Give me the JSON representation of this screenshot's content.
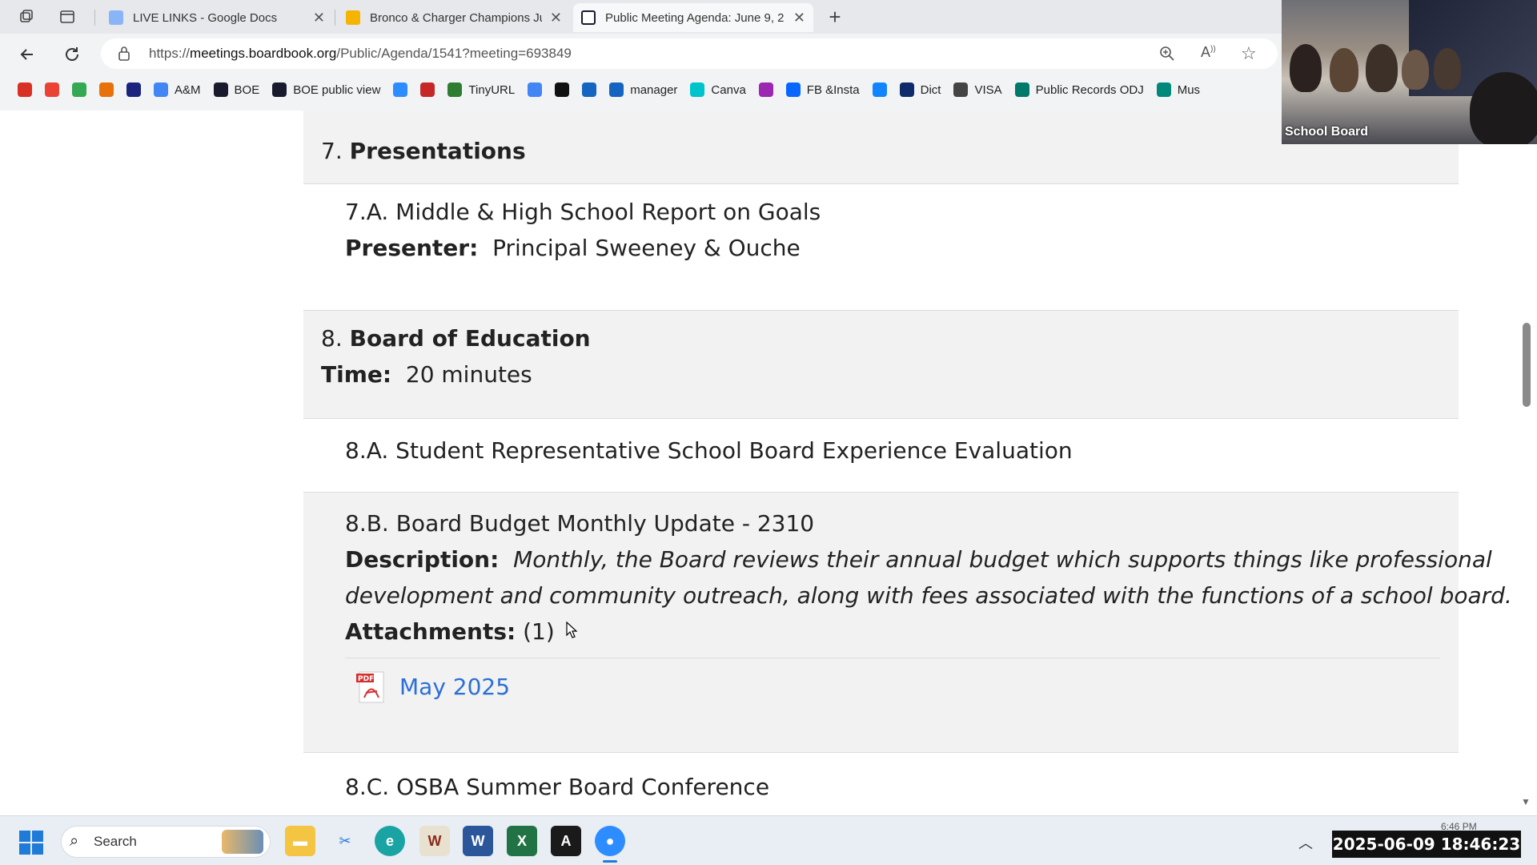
{
  "browser": {
    "tabs": [
      {
        "title": "LIVE LINKS - Google Docs",
        "color": "#8ab4f8"
      },
      {
        "title": "Bronco & Charger Champions Jun",
        "color": "#f4b400"
      },
      {
        "title": "Public Meeting Agenda: June 9, 2",
        "color": "#1a1a2e"
      }
    ],
    "url_prefix": "https://",
    "url_domain": "meetings.boardbook.org",
    "url_path": "/Public/Agenda/1541?meeting=693849",
    "bookmarks": [
      {
        "label": "",
        "icon": "red-circle-icon",
        "color": "#d93025"
      },
      {
        "label": "",
        "icon": "gmail-icon",
        "color": "#ea4335"
      },
      {
        "label": "",
        "icon": "drive-icon",
        "color": "#34a853"
      },
      {
        "label": "",
        "icon": "photos-icon",
        "color": "#e8710a"
      },
      {
        "label": "",
        "icon": "ring-icon",
        "color": "#1a237e"
      },
      {
        "label": "A&M",
        "icon": "doc-icon",
        "color": "#4285f4"
      },
      {
        "label": "BOE",
        "icon": "board-icon",
        "color": "#1a1a2e"
      },
      {
        "label": "BOE public view",
        "icon": "board-icon",
        "color": "#1a1a2e"
      },
      {
        "label": "",
        "icon": "zoom-icon",
        "color": "#2d8cff"
      },
      {
        "label": "",
        "icon": "pen-icon",
        "color": "#c62828"
      },
      {
        "label": "TinyURL",
        "icon": "link-icon",
        "color": "#2e7d32"
      },
      {
        "label": "",
        "icon": "sparkle-icon",
        "color": "#4285f4"
      },
      {
        "label": "",
        "icon": "openai-icon",
        "color": "#111111"
      },
      {
        "label": "",
        "icon": "hourglass-icon",
        "color": "#1565c0"
      },
      {
        "label": "manager",
        "icon": "hourglass-icon",
        "color": "#1565c0"
      },
      {
        "label": "Canva",
        "icon": "canva-icon",
        "color": "#00c4cc"
      },
      {
        "label": "",
        "icon": "grid-icon",
        "color": "#9c27b0"
      },
      {
        "label": "FB &Insta",
        "icon": "meta-icon",
        "color": "#0866ff"
      },
      {
        "label": "",
        "icon": "butterfly-icon",
        "color": "#1185fe"
      },
      {
        "label": "Dict",
        "icon": "dict-icon",
        "color": "#0d2b6b"
      },
      {
        "label": "VISA",
        "icon": "globe-icon",
        "color": "#444444"
      },
      {
        "label": "Public Records ODJ",
        "icon": "folder-icon",
        "color": "#00796b"
      },
      {
        "label": "Mus",
        "icon": "chart-icon",
        "color": "#00897b"
      }
    ]
  },
  "agenda": {
    "item7": {
      "num": "7.",
      "title": "Presentations"
    },
    "item7a": {
      "title": "7.A. Middle & High School Report on Goals",
      "presenter_label": "Presenter:",
      "presenter": "Principal Sweeney & Ouche"
    },
    "item8": {
      "num": "8.",
      "title": "Board of Education",
      "time_label": "Time:",
      "time": "20 minutes"
    },
    "item8a": {
      "title": "8.A. Student Representative School Board Experience Evaluation"
    },
    "item8b": {
      "title": "8.B. Board Budget Monthly Update - 2310",
      "description_label": "Description:",
      "description_line1": "Monthly, the Board reviews their annual budget which supports things like professional",
      "description_line2": "development and community outreach, along with fees associated with the functions of a school board.",
      "attachments_label": "Attachments:",
      "attachments_count": "(1)",
      "attachment_link": "May 2025"
    },
    "item8c": {
      "title": "8.C. OSBA Summer Board Conference"
    }
  },
  "video": {
    "label": "School Board"
  },
  "taskbar": {
    "search_placeholder": "Search",
    "clock": "2025-06-09  18:46:23",
    "clock_small": "6:46 PM"
  }
}
